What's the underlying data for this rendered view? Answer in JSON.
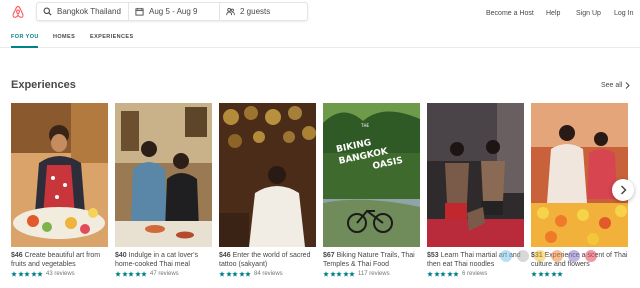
{
  "header": {
    "search": {
      "location": "Bangkok Thailand",
      "dates": "Aug 5 - Aug 9",
      "guests": "2 guests"
    },
    "nav": {
      "become_host": "Become a Host",
      "help": "Help",
      "sign_up": "Sign Up",
      "log_in": "Log In"
    }
  },
  "tabs": [
    "FOR YOU",
    "HOMES",
    "EXPERIENCES"
  ],
  "section": {
    "title": "Experiences",
    "see_all": "See all"
  },
  "cards": [
    {
      "price": "$46",
      "title": "Create beautiful art from fruits and vegetables",
      "stars": 5,
      "reviews": "43 reviews"
    },
    {
      "price": "$40",
      "title": "Indulge in a cat lover's home-cooked Thai meal",
      "stars": 5,
      "reviews": "47 reviews"
    },
    {
      "price": "$46",
      "title": "Enter the world of sacred tattoo (sakyant)",
      "stars": 5,
      "reviews": "84 reviews"
    },
    {
      "price": "$67",
      "title": "Biking Nature Trails, Thai Temples & Thai Food",
      "stars": 5,
      "reviews": "117 reviews",
      "overlay": "BIKING BANGKOK OASIS",
      "overlay_small": "THE"
    },
    {
      "price": "$53",
      "title": "Learn Thai martial art and then eat Thai noodles",
      "stars": 5,
      "reviews": "6 reviews"
    },
    {
      "price": "$31",
      "title": "Experience a scent of Thai culture and flowers",
      "stars": 5,
      "reviews": ""
    }
  ],
  "colors": {
    "brand": "#FF5A5F",
    "accent": "#008489",
    "star": "#008489"
  }
}
